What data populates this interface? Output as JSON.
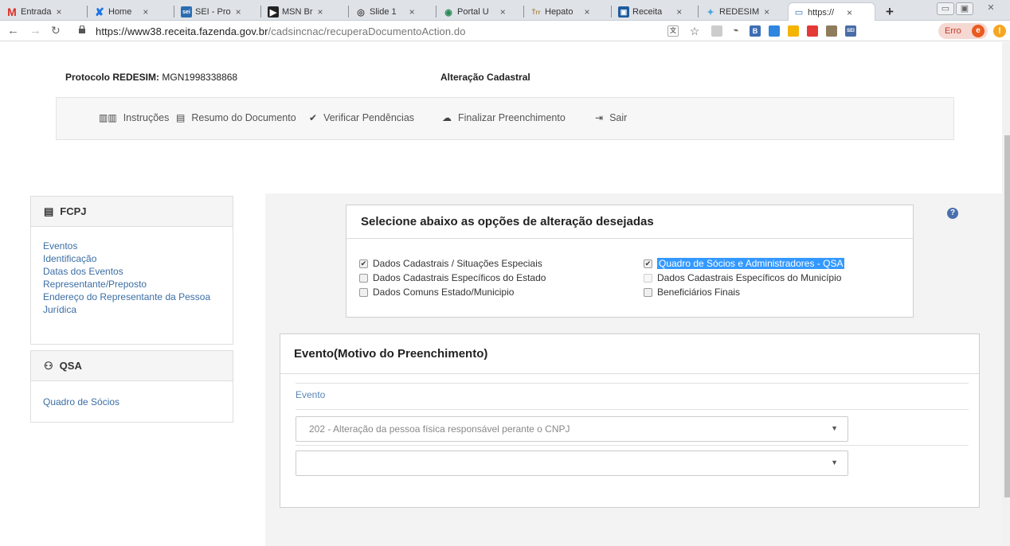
{
  "browser": {
    "tabs": [
      {
        "label": "Entrada",
        "icon": "gmail-icon"
      },
      {
        "label": "Home",
        "icon": "home-icon"
      },
      {
        "label": "SEI - Pro",
        "icon": "sei-icon"
      },
      {
        "label": "MSN Br",
        "icon": "msn-icon"
      },
      {
        "label": "Slide 1",
        "icon": "slide-icon"
      },
      {
        "label": "Portal U",
        "icon": "portal-icon"
      },
      {
        "label": "Hepato",
        "icon": "hepato-icon"
      },
      {
        "label": "Receita",
        "icon": "receita-icon"
      },
      {
        "label": "REDESIM",
        "icon": "redesim-icon"
      },
      {
        "label": "https://",
        "icon": "page-icon"
      }
    ],
    "new_tab": "+",
    "url_domain": "https://www38.receita.fazenda.gov.br",
    "url_path": "/cadsincnac/recuperaDocumentoAction.do",
    "error_label": "Erro",
    "error_badge": "e",
    "alert_badge": "!",
    "ext_labels": [
      "B",
      "SEI"
    ]
  },
  "header": {
    "protocol_label": "Protocolo REDESIM:",
    "protocol_value": "MGN1998338868",
    "title": "Alteração Cadastral"
  },
  "menu": {
    "instrucoes": "Instruções",
    "resumo": "Resumo do Documento",
    "pendencias": "Verificar Pendências",
    "finalizar": "Finalizar Preenchimento",
    "sair": "Sair"
  },
  "fcpj": {
    "title": "FCPJ",
    "links": [
      "Eventos",
      "Identificação",
      "Datas dos Eventos",
      "Representante/Preposto",
      "Endereço do Representante da Pessoa",
      "Jurídica"
    ]
  },
  "qsa": {
    "title": "QSA",
    "links": [
      "Quadro de Sócios"
    ]
  },
  "options": {
    "title": "Selecione abaixo as opções de alteração desejadas",
    "left": [
      {
        "label": "Dados Cadastrais / Situações Especiais",
        "checked": true
      },
      {
        "label": "Dados Cadastrais Específicos do Estado",
        "checked": false
      },
      {
        "label": "Dados Comuns Estado/Municipio",
        "checked": false
      }
    ],
    "right": [
      {
        "label": "Quadro de Sócios e Administradores - QSA",
        "checked": true
      },
      {
        "label": "Dados Cadastrais Específicos do Município",
        "checked": false,
        "disabled": true
      },
      {
        "label": "Beneficiários Finais",
        "checked": false
      }
    ]
  },
  "evento": {
    "title": "Evento(Motivo do Preenchimento)",
    "label": "Evento",
    "select1": "202 - Alteração da pessoa física responsável perante o CNPJ",
    "select2": ""
  },
  "colors": {
    "link": "#3b6ea5",
    "highlight": "#3399ff",
    "gray_band": "#f3f3f3"
  }
}
